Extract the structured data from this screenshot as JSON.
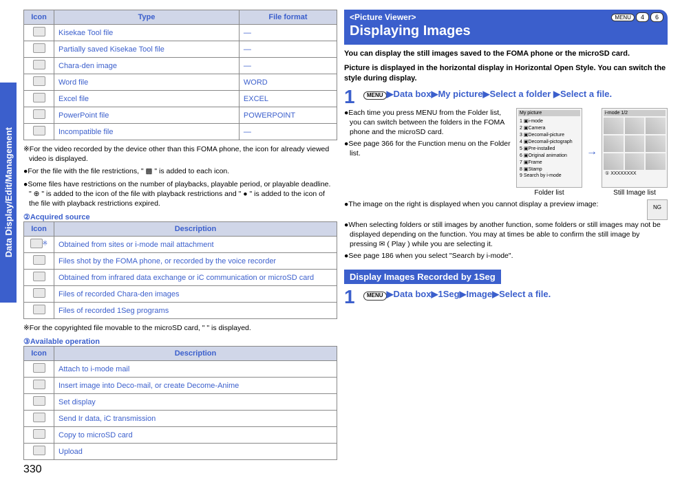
{
  "side_tab": "Data Display/Edit/Management",
  "page_number": "330",
  "left": {
    "table1": {
      "headers": [
        "Icon",
        "Type",
        "File format"
      ],
      "rows": [
        {
          "type": "Kisekae Tool file",
          "fmt": "—"
        },
        {
          "type": "Partially saved Kisekae Tool file",
          "fmt": "—"
        },
        {
          "type": "Chara-den image",
          "fmt": "—"
        },
        {
          "type": "Word file",
          "fmt": "WORD"
        },
        {
          "type": "Excel file",
          "fmt": "EXCEL"
        },
        {
          "type": "PowerPoint file",
          "fmt": "POWERPOINT"
        },
        {
          "type": "Incompatible file",
          "fmt": "—"
        }
      ]
    },
    "note_video": "※For the video recorded by the device other than this FOMA phone, the icon for already viewed video is displayed.",
    "note_restrict": "●For the file with the file restrictions, \" ▩ \" is added to each icon.",
    "note_playback": "●Some files have restrictions on the number of playbacks, playable period, or playable deadline. \" ⊕ \" is added to the icon of the file with playback restrictions and \" ● \" is added to the icon of the file with playback restrictions expired.",
    "head_acquired": "②Acquired source",
    "table2": {
      "headers": [
        "Icon",
        "Description"
      ],
      "rows": [
        {
          "desc": "Obtained from sites or i-mode mail attachment",
          "mark": "※"
        },
        {
          "desc": "Files shot by the FOMA phone, or recorded by the voice recorder",
          "mark": ""
        },
        {
          "desc": "Obtained from infrared data exchange or iC communication or microSD card",
          "mark": ""
        },
        {
          "desc": "Files of recorded Chara-den images",
          "mark": ""
        },
        {
          "desc": "Files of recorded 1Seg programs",
          "mark": ""
        }
      ]
    },
    "note_movable": "※For the copyrighted file movable to the microSD card, \"  \" is displayed.",
    "head_avail": "③Available operation",
    "table3": {
      "headers": [
        "Icon",
        "Description"
      ],
      "rows": [
        {
          "desc": "Attach to i-mode mail"
        },
        {
          "desc": "Insert image into Deco-mail, or create Decome-Anime"
        },
        {
          "desc": "Set display"
        },
        {
          "desc": "Send Ir data, iC transmission"
        },
        {
          "desc": "Copy to microSD card"
        },
        {
          "desc": "Upload"
        }
      ]
    }
  },
  "right": {
    "banner_tag": "<Picture Viewer>",
    "banner_title": "Displaying Images",
    "banner_keys": [
      "MENU",
      "4",
      "6"
    ],
    "lead1": "You can display the still images saved to the FOMA phone or the microSD card.",
    "lead2": "Picture is displayed in the horizontal display in Horizontal Open Style. You can switch the style during display.",
    "step1_num": "1",
    "step1_menu": "MENU",
    "step1_line": "▶Data box▶My picture▶Select a folder ▶Select a file.",
    "bullets1_a": "●Each time you press MENU from the Folder list, you can switch between the folders in the FOMA phone and the microSD card.",
    "bullets1_b": "●See page 366 for the Function menu on the Folder list.",
    "folder_list_label": "Folder list",
    "still_list_label": "Still Image list",
    "folder_screen_title": "My picture",
    "folder_items": [
      "1 ▣i-mode",
      "2 ▣Camera",
      "3 ▣Decomail-picture",
      "4 ▣Decomail-pictograph",
      "5 ▣Pre-installed",
      "6 ▣Original animation",
      "7 ▣Frame",
      "8 ▣Stamp",
      "9  Search by i-mode"
    ],
    "image_screen_title": "i-mode          1/2",
    "image_caption": "① XXXXXXXX",
    "bullet_preview": "●The image on the right is displayed when you cannot display a preview image:",
    "ng_label": "NG",
    "bullet_select": "●When selecting folders or still images by another function, some folders or still images may not be displayed depending on the function. You may at times be able to confirm the still image by pressing ✉ ( Play ) while you are selecting it.",
    "bullet_search": "●See page 186 when you select \"Search by i-mode\".",
    "subhead_1seg": "Display Images Recorded by 1Seg",
    "step2_num": "1",
    "step2_menu": "MENU",
    "step2_line": "▶Data box▶1Seg▶Image▶Select a file."
  }
}
